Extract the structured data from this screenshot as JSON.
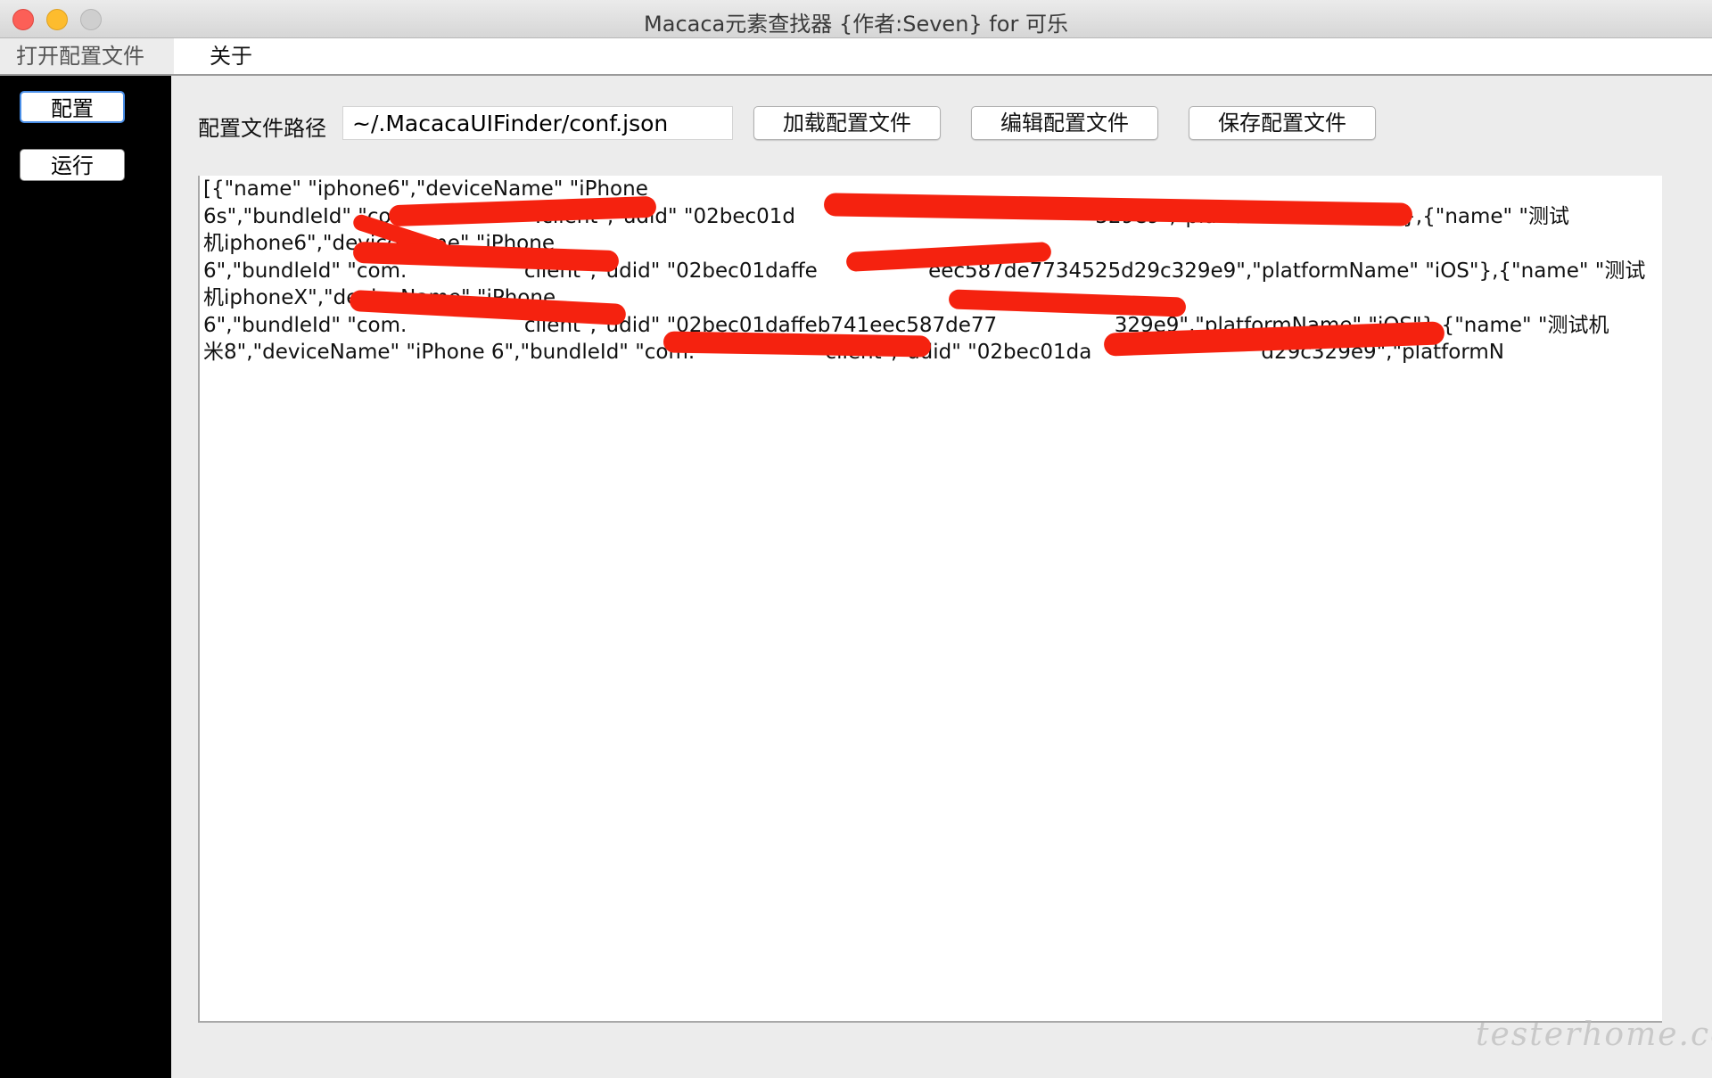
{
  "window": {
    "title": "Macaca元素查找器 {作者:Seven} for 可乐"
  },
  "menu": {
    "open_config": "打开配置文件",
    "about": "关于"
  },
  "sidebar": {
    "items": [
      {
        "label": "配置",
        "selected": true
      },
      {
        "label": "运行",
        "selected": false
      }
    ]
  },
  "config": {
    "path_label": "配置文件路径",
    "path_value": "~/.MacacaUIFinder/conf.json",
    "load_button": "加载配置文件",
    "edit_button": "编辑配置文件",
    "save_button": "保存配置文件",
    "content": "[{\"name\" \"iphone6\",\"deviceName\" \"iPhone\n6s\",\"bundleId\" \"com.                  .client\",\"udid\" \"02bec01d                                              329e9\",\"platformName\" \"iOS\"},{\"name\" \"测试\n机iphone6\",\"deviceName\" \"iPhone\n6\",\"bundleId\" \"com.                  client\",\"udid\" \"02bec01daffe                 eec587de7734525d29c329e9\",\"platformName\" \"iOS\"},{\"name\" \"测试\n机iphoneX\",\"deviceName\" \"iPhone\n6\",\"bundleId\" \"com.                  client\",\"udid\" \"02bec01daffeb741eec587de77                  329e9\",\"platformName\" \"iOS\"},{\"name\" \"测试机\n米8\",\"deviceName\" \"iPhone 6\",\"bundleId\" \"com.                    client\",\"udid\" \"02bec01da                          d29c329e9\",\"platformN"
  },
  "watermark": "testerhome.com",
  "colors": {
    "sidebar_bg": "#000000",
    "redaction": "#f5220f",
    "selected_border": "#4a8fe8"
  }
}
